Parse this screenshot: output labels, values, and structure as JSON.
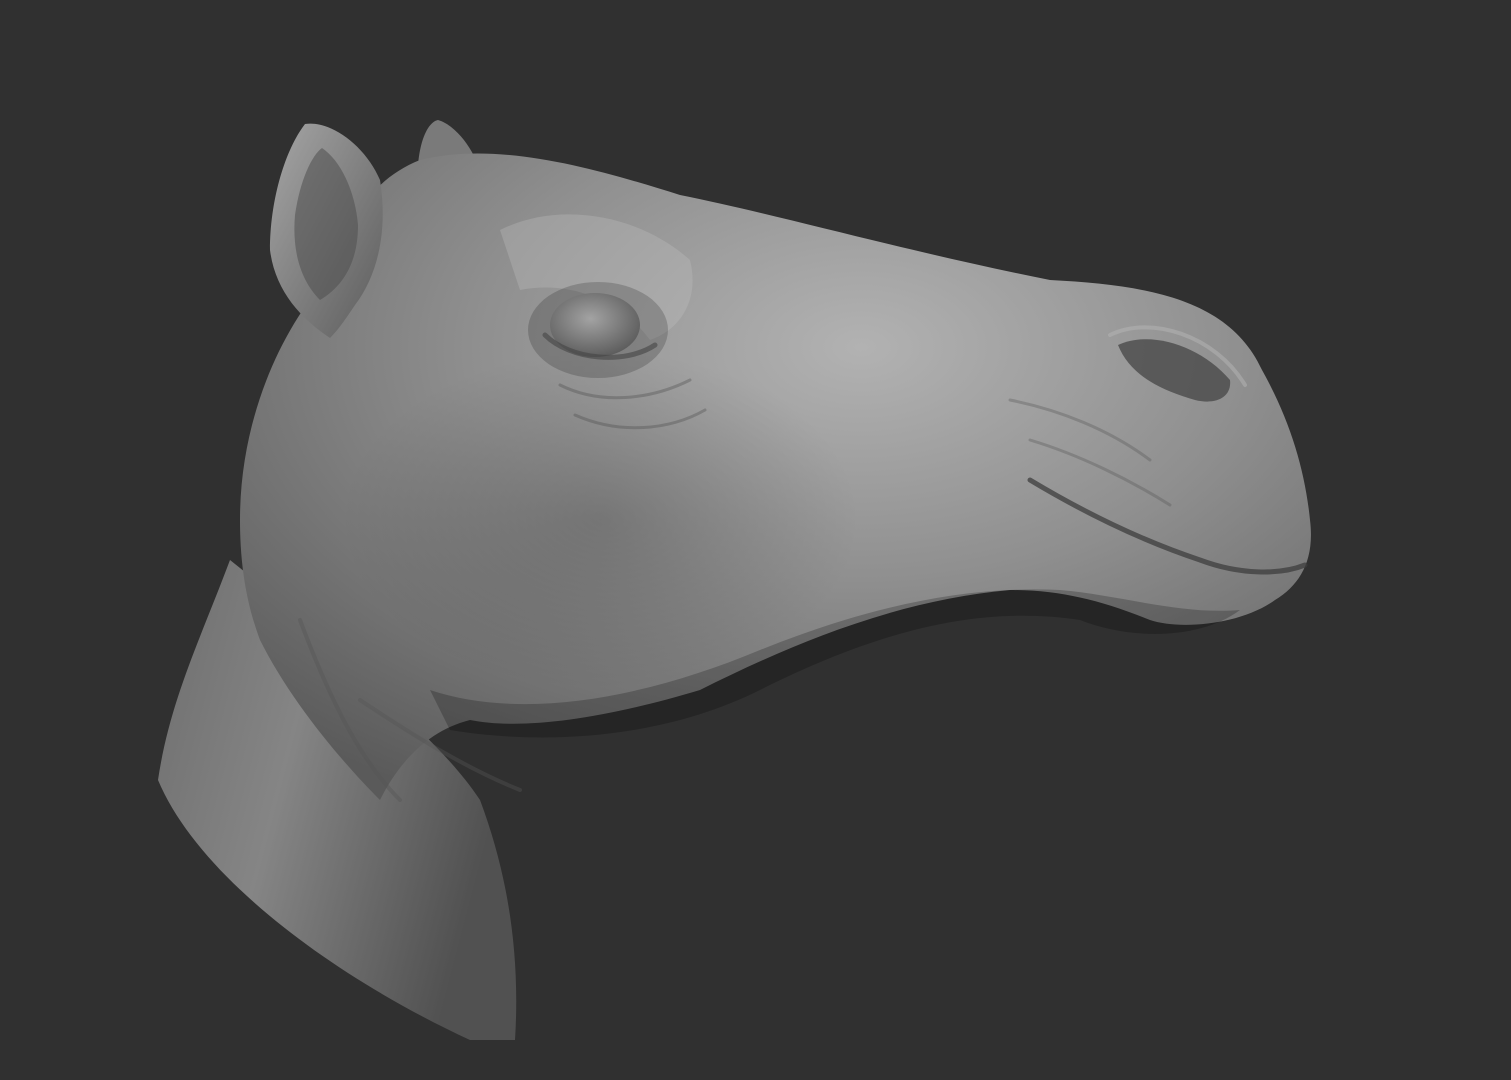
{
  "scene": {
    "subject": "camel-head-sculpt",
    "colors": {
      "background": "#303030",
      "clay_light": "#a4a4a4",
      "clay_mid": "#7d7d7d",
      "clay_shadow": "#3e3e3e"
    }
  }
}
